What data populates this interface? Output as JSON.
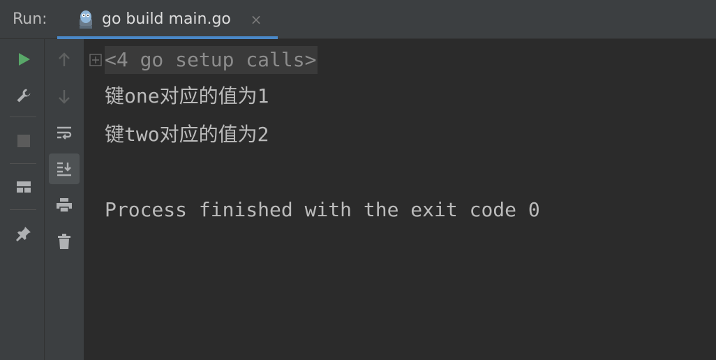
{
  "run_panel": {
    "title": "Run:",
    "tab": {
      "label": "go build main.go",
      "icon": "gopher-icon",
      "close_glyph": "×"
    }
  },
  "left_toolbar": [
    {
      "name": "rerun-button",
      "icon": "play-icon",
      "color": "#59a869"
    },
    {
      "name": "edit-configuration-button",
      "icon": "wrench-icon"
    },
    {
      "name": "stop-button",
      "icon": "stop-icon",
      "enabled": false
    },
    {
      "name": "restore-layout-button",
      "icon": "layout-icon"
    },
    {
      "name": "pin-tab-button",
      "icon": "pin-icon"
    }
  ],
  "right_toolbar": [
    {
      "name": "up-stack-trace-button",
      "icon": "arrow-up-icon",
      "enabled": false
    },
    {
      "name": "down-stack-trace-button",
      "icon": "arrow-down-icon",
      "enabled": false
    },
    {
      "name": "soft-wrap-button",
      "icon": "soft-wrap-icon"
    },
    {
      "name": "scroll-to-end-button",
      "icon": "scroll-to-end-icon",
      "active": true
    },
    {
      "name": "print-button",
      "icon": "printer-icon"
    },
    {
      "name": "clear-all-button",
      "icon": "trash-icon"
    }
  ],
  "console": {
    "fold_icon": "expand-icon",
    "collapsed_line": "<4 go setup calls>",
    "lines": [
      "键one对应的值为1",
      "键two对应的值为2",
      "",
      "Process finished with the exit code 0"
    ]
  },
  "colors": {
    "accent": "#4a88c7",
    "background": "#2b2b2b",
    "toolbar": "#3c3f41",
    "text": "#bbbbbb",
    "run_green": "#59a869"
  }
}
